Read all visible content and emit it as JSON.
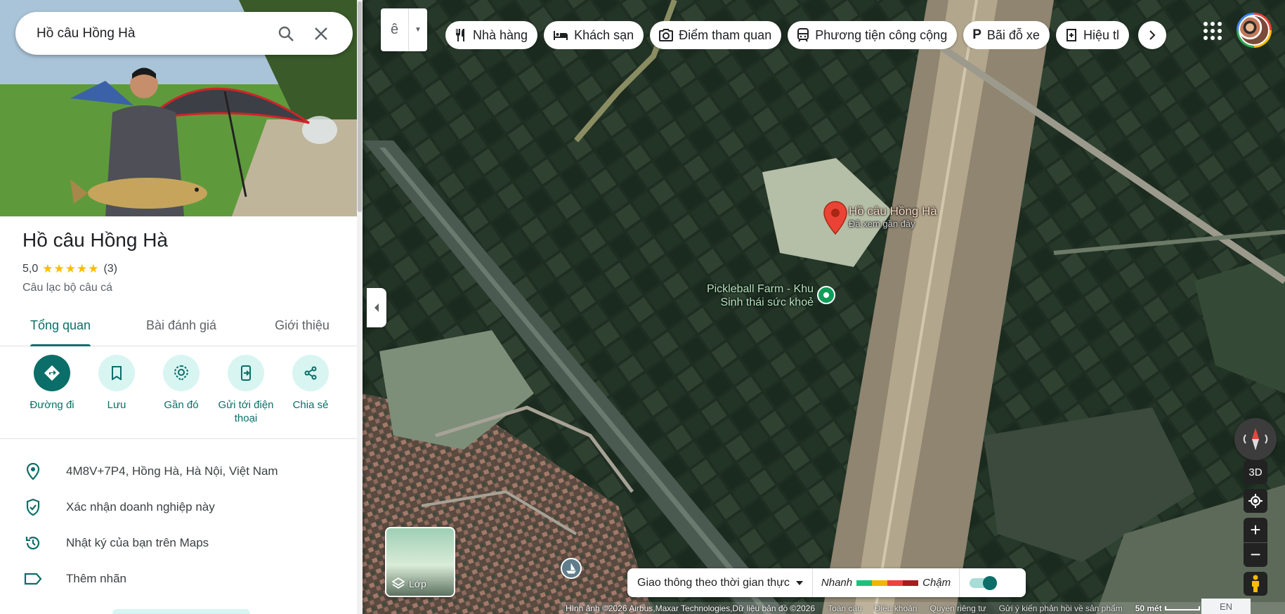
{
  "search": {
    "query": "Hồ câu Hồng Hà"
  },
  "place": {
    "title": "Hồ câu Hồng Hà",
    "rating": "5,0",
    "stars": "★★★★★",
    "review_count": "(3)",
    "category": "Câu lạc bộ câu cá"
  },
  "tabs": [
    {
      "label": "Tổng quan"
    },
    {
      "label": "Bài đánh giá"
    },
    {
      "label": "Giới thiệu"
    }
  ],
  "actions": [
    {
      "label": "Đường đi",
      "icon": "directions-icon"
    },
    {
      "label": "Lưu",
      "icon": "bookmark-icon"
    },
    {
      "label": "Gần đó",
      "icon": "nearby-icon"
    },
    {
      "label": "Gửi tới điện thoại",
      "icon": "send-to-phone-icon"
    },
    {
      "label": "Chia sẻ",
      "icon": "share-icon"
    }
  ],
  "info": [
    {
      "text": "4M8V+7P4, Hồng Hà, Hà Nội, Việt Nam",
      "icon": "location-pin-icon"
    },
    {
      "text": "Xác nhận doanh nghiệp này",
      "icon": "verified-shield-icon"
    },
    {
      "text": "Nhật ký của bạn trên Maps",
      "icon": "history-icon"
    },
    {
      "text": "Thêm nhãn",
      "icon": "label-icon"
    }
  ],
  "ime": {
    "key": "ê"
  },
  "chips": [
    {
      "label": "Nhà hàng",
      "icon": "restaurant-icon"
    },
    {
      "label": "Khách sạn",
      "icon": "hotel-icon"
    },
    {
      "label": "Điểm tham quan",
      "icon": "camera-icon"
    },
    {
      "label": "Phương tiện công cộng",
      "icon": "transit-icon"
    },
    {
      "label": "Bãi đỗ xe",
      "icon": "parking-icon"
    },
    {
      "label": "Hiệu tl",
      "icon": "pharmacy-icon"
    }
  ],
  "map": {
    "main_pin": {
      "title": "Hồ câu Hồng Hà",
      "subtitle": "Đã xem gần đây"
    },
    "poi": {
      "title_line1": "Pickleball Farm - Khu",
      "title_line2": "Sinh thái sức khoẻ"
    }
  },
  "layers": {
    "label": "Lớp"
  },
  "traffic": {
    "select_label": "Giao thông theo thời gian thực",
    "fast": "Nhanh",
    "slow": "Chậm",
    "colors": [
      "#1ec07c",
      "#f4b400",
      "#e8453c",
      "#a51d1d"
    ]
  },
  "controls": {
    "three_d": "3D"
  },
  "footer": {
    "attribution": "Hình ảnh ©2026 Airbus,Maxar Technologies,Dữ liệu bản đồ ©2026",
    "global": "Toàn cầu",
    "terms": "Điều khoản",
    "privacy": "Quyền riêng tư",
    "feedback": "Gửi ý kiến phản hồi về sản phẩm",
    "scale": "50 mét",
    "lang": "EN"
  },
  "colors": {
    "accent": "#0b6e69",
    "accent_light": "#d8f5f2",
    "pin": "#ea4335",
    "star": "#fbbc04"
  }
}
